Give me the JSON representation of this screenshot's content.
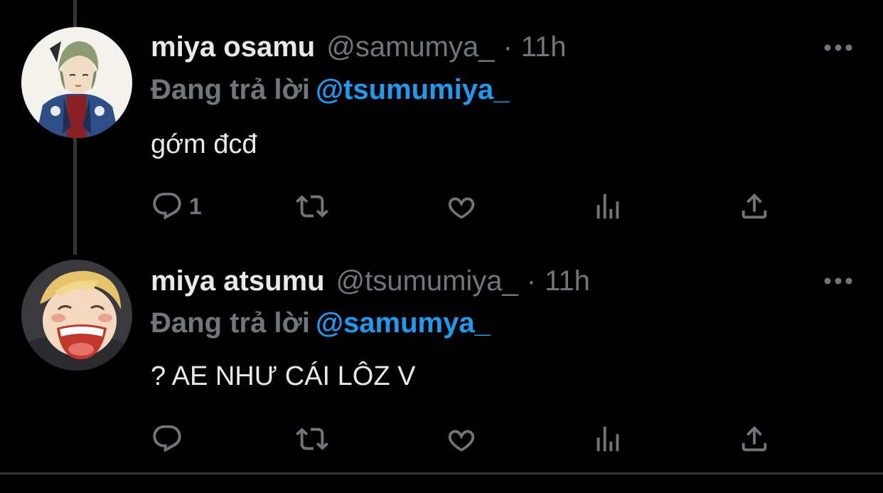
{
  "thread": {
    "tweets": [
      {
        "name": "miya osamu",
        "handle": "@samumya_",
        "separator": "·",
        "time": "11h",
        "reply_prefix": "Đang trả lời",
        "reply_to": "@tsumumiya_",
        "text": "gớm đcđ",
        "reply_count": "1",
        "avatar_icon": "avatar-green-hair"
      },
      {
        "name": "miya atsumu",
        "handle": "@tsumumiya_",
        "separator": "·",
        "time": "11h",
        "reply_prefix": "Đang trả lời",
        "reply_to": "@samumya_",
        "text": "? AE NHƯ CÁI LÔZ V",
        "reply_count": "",
        "avatar_icon": "avatar-blond-laughing"
      }
    ]
  },
  "colors": {
    "background": "#000000",
    "primary_text": "#e7e9ea",
    "secondary_text": "#71767b",
    "mention": "#1d9bf0",
    "thread_line": "#333639"
  },
  "icons": [
    "reply-icon",
    "retweet-icon",
    "like-icon",
    "analytics-icon",
    "share-icon",
    "more-icon"
  ]
}
